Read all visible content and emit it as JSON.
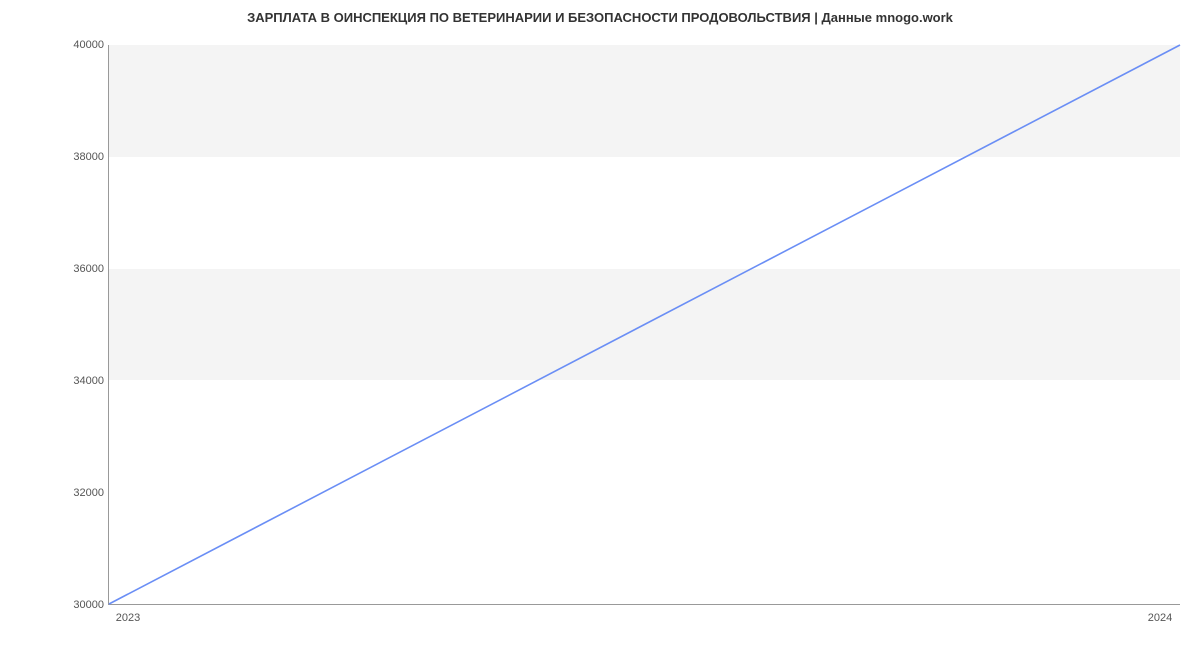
{
  "chart_data": {
    "type": "line",
    "title": "ЗАРПЛАТА В ОИНСПЕКЦИЯ ПО ВЕТЕРИНАРИИ И БЕЗОПАСНОСТИ ПРОДОВОЛЬСТВИЯ | Данные mnogo.work",
    "xlabel": "",
    "ylabel": "",
    "x_ticks": [
      "2023",
      "2024"
    ],
    "y_ticks": [
      30000,
      32000,
      34000,
      36000,
      38000,
      40000
    ],
    "ylim": [
      30000,
      40000
    ],
    "xlim": [
      2023,
      2024
    ],
    "x": [
      2023,
      2024
    ],
    "series": [
      {
        "name": "salary",
        "values": [
          30000,
          40000
        ],
        "color": "#6a8ef5"
      }
    ]
  }
}
